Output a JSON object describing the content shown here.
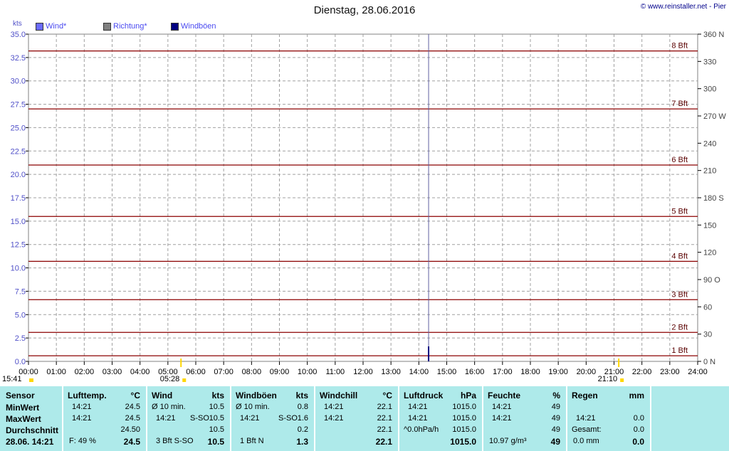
{
  "title": "Dienstag, 28.06.2016",
  "copyright": "© www.reinstaller.net - Pier",
  "legend": [
    {
      "label": "Wind*",
      "color": "#6b6bff"
    },
    {
      "label": "Richtung*",
      "color": "#808080"
    },
    {
      "label": "Windböen",
      "color": "#000080"
    }
  ],
  "chart_data": {
    "type": "line",
    "y_unit_label": "kts",
    "y_ticks": [
      "0.0",
      "2.5",
      "5.0",
      "7.5",
      "10.0",
      "12.5",
      "15.0",
      "17.5",
      "20.0",
      "22.5",
      "25.0",
      "27.5",
      "30.0",
      "32.5",
      "35.0"
    ],
    "ylim": [
      0,
      35
    ],
    "y2_ticks": [
      "0 N",
      "30",
      "60",
      "90 O",
      "120",
      "150",
      "180 S",
      "210",
      "240",
      "270 W",
      "300",
      "330",
      "360 N"
    ],
    "y2lim": [
      0,
      360
    ],
    "x_ticks": [
      "00:00",
      "01:00",
      "02:00",
      "03:00",
      "04:00",
      "05:00",
      "06:00",
      "07:00",
      "08:00",
      "09:00",
      "10:00",
      "11:00",
      "12:00",
      "13:00",
      "14:00",
      "15:00",
      "16:00",
      "17:00",
      "18:00",
      "19:00",
      "20:00",
      "21:00",
      "22:00",
      "23:00",
      "24:00"
    ],
    "xlim": [
      0,
      24
    ],
    "beaufort": [
      {
        "label": "1 Bft",
        "kts": 0.6
      },
      {
        "label": "2 Bft",
        "kts": 3.1
      },
      {
        "label": "3 Bft",
        "kts": 6.6
      },
      {
        "label": "4 Bft",
        "kts": 10.7
      },
      {
        "label": "5 Bft",
        "kts": 15.5
      },
      {
        "label": "6 Bft",
        "kts": 21.0
      },
      {
        "label": "7 Bft",
        "kts": 27.0
      },
      {
        "label": "8 Bft",
        "kts": 33.2
      }
    ],
    "current_time_hours": 14.35,
    "series": [
      {
        "name": "Windböen",
        "x": [
          14.35
        ],
        "values": [
          1.6
        ]
      }
    ],
    "sun_markers": [
      {
        "hours": 5.47,
        "label": "05:28"
      },
      {
        "hours": 21.17,
        "label": "21:10"
      }
    ],
    "start_marker": {
      "label": "15:41"
    },
    "grid": true
  },
  "colors": {
    "table_bg": "#aeeaea",
    "bft_line": "#8b0000",
    "grid": "#a0a0a0",
    "axis_text": "#5050c8"
  },
  "table": {
    "sensor": {
      "header": "Sensor",
      "rows": [
        "MinWert",
        "MaxWert",
        "Durchschnitt",
        "28.06. 14:21"
      ]
    },
    "lufttemp": {
      "header": "Lufttemp.",
      "unit": "°C",
      "min_time": "14:21",
      "min_val": "24.5",
      "max_time": "14:21",
      "max_val": "24.5",
      "avg": "24.50",
      "cur_extra": "F: 49 %",
      "cur_val": "24.5"
    },
    "wind": {
      "header": "Wind",
      "unit": "kts",
      "min_label": "Ø 10 min.",
      "min_val": "10.5",
      "max_time": "14:21",
      "max_dir": "S-SO",
      "max_val": "10.5",
      "avg": "10.5",
      "cur_extra": "3 Bft S-SO",
      "cur_val": "10.5"
    },
    "windboeen": {
      "header": "Windböen",
      "unit": "kts",
      "min_label": "Ø 10 min.",
      "min_val": "0.8",
      "max_time": "14:21",
      "max_dir": "S-SO",
      "max_val": "1.6",
      "avg": "0.2",
      "cur_extra": "1 Bft N",
      "cur_val": "1.3"
    },
    "windchill": {
      "header": "Windchill",
      "unit": "°C",
      "min_time": "14:21",
      "min_val": "22.1",
      "max_time": "14:21",
      "max_val": "22.1",
      "avg": "22.1",
      "cur_val": "22.1"
    },
    "luftdruck": {
      "header": "Luftdruck",
      "unit": "hPa",
      "min_time": "14:21",
      "min_val": "1015.0",
      "max_time": "14:21",
      "max_val": "1015.0",
      "avg_label": "^0.0hPa/h",
      "avg": "1015.0",
      "cur_val": "1015.0"
    },
    "feuchte": {
      "header": "Feuchte",
      "unit": "%",
      "min_time": "14:21",
      "min_val": "49",
      "max_time": "14:21",
      "max_val": "49",
      "avg": "49",
      "cur_extra": "10.97 g/m³",
      "cur_val": "49"
    },
    "regen": {
      "header": "Regen",
      "unit": "mm",
      "max_time": "14:21",
      "max_val": "0.0",
      "avg_label": "Gesamt:",
      "avg": "0.0",
      "cur_extra": "0.0 mm",
      "cur_val": "0.0"
    }
  }
}
